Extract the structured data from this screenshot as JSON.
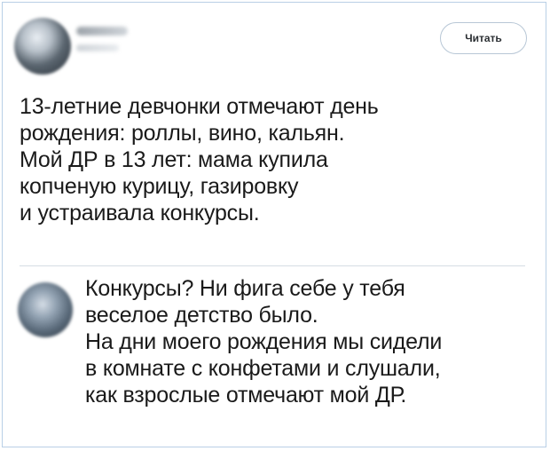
{
  "post": {
    "follow_label": "Читать",
    "text_lines": [
      "13-летние девчонки отмечают день",
      "рождения: роллы, вино, кальян.",
      "Мой ДР в 13 лет: мама купила",
      "копченую курицу, газировку",
      "и устраивала конкурсы."
    ]
  },
  "reply": {
    "text_lines": [
      "Конкурсы? Ни фига себе у тебя",
      "веселое детство было.",
      "На дни моего рождения мы сидели",
      "в комнате с конфетами и слушали,",
      "как взрослые отмечают мой ДР."
    ]
  }
}
